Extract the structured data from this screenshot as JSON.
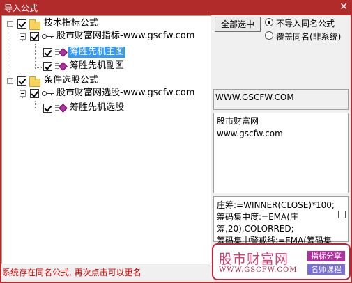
{
  "window": {
    "title": "导入公式",
    "close_label": "✕"
  },
  "tree": {
    "groups": [
      {
        "label": "技术指标公式",
        "site": "股市财富网指标-www.gscfw.com",
        "items": [
          "筹胜先机主图",
          "筹胜先机副图"
        ]
      },
      {
        "label": "条件选股公式",
        "site": "股市财富网选股-www.gscfw.com",
        "items": [
          "筹胜先机选股"
        ]
      }
    ],
    "selected_item": "筹胜先机主图"
  },
  "controls": {
    "select_all_label": "全部选中",
    "radio_options": [
      {
        "label": "不导入同名公式",
        "selected": true
      },
      {
        "label": "覆盖同名(非系统)",
        "selected": false
      }
    ]
  },
  "info": {
    "url_box": "WWW.GSCFW.COM",
    "desc_lines": [
      "股市财富网",
      "www.gscfw.com"
    ],
    "code_lines": [
      "庄筹:=WINNER(CLOSE)*100;",
      "筹码集中度:=EMA(庄",
      "筹,20),COLORRED;",
      "筹码集中警戒线:=EMA(筹码集"
    ]
  },
  "status_text": "系统存在同名公式, 再次点击可以更名",
  "watermark": {
    "name_cn": "股市财富网",
    "url": "WWW.GSCFW.COM",
    "tag1": "指标分享",
    "tag2": "名师课程"
  }
}
